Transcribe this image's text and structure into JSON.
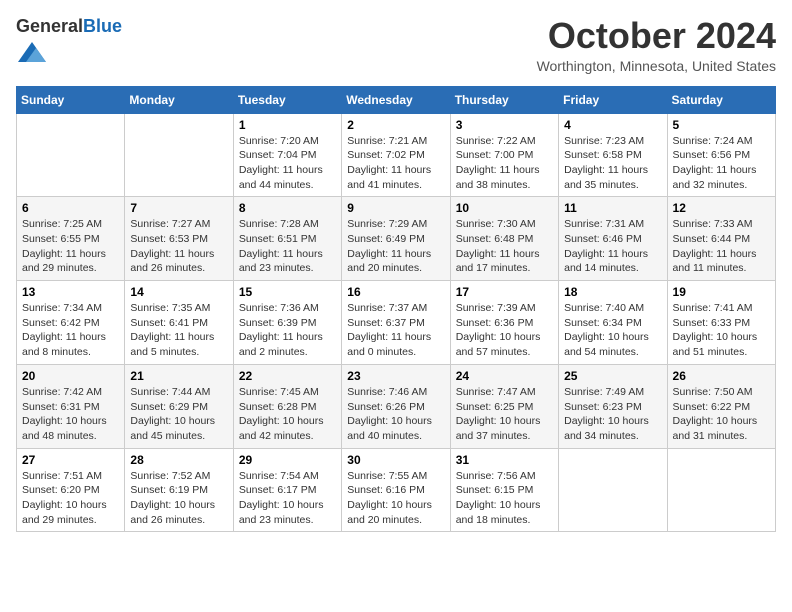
{
  "header": {
    "logo_general": "General",
    "logo_blue": "Blue",
    "month_title": "October 2024",
    "location": "Worthington, Minnesota, United States"
  },
  "weekdays": [
    "Sunday",
    "Monday",
    "Tuesday",
    "Wednesday",
    "Thursday",
    "Friday",
    "Saturday"
  ],
  "weeks": [
    [
      {
        "day": "",
        "info": ""
      },
      {
        "day": "",
        "info": ""
      },
      {
        "day": "1",
        "info": "Sunrise: 7:20 AM\nSunset: 7:04 PM\nDaylight: 11 hours and 44 minutes."
      },
      {
        "day": "2",
        "info": "Sunrise: 7:21 AM\nSunset: 7:02 PM\nDaylight: 11 hours and 41 minutes."
      },
      {
        "day": "3",
        "info": "Sunrise: 7:22 AM\nSunset: 7:00 PM\nDaylight: 11 hours and 38 minutes."
      },
      {
        "day": "4",
        "info": "Sunrise: 7:23 AM\nSunset: 6:58 PM\nDaylight: 11 hours and 35 minutes."
      },
      {
        "day": "5",
        "info": "Sunrise: 7:24 AM\nSunset: 6:56 PM\nDaylight: 11 hours and 32 minutes."
      }
    ],
    [
      {
        "day": "6",
        "info": "Sunrise: 7:25 AM\nSunset: 6:55 PM\nDaylight: 11 hours and 29 minutes."
      },
      {
        "day": "7",
        "info": "Sunrise: 7:27 AM\nSunset: 6:53 PM\nDaylight: 11 hours and 26 minutes."
      },
      {
        "day": "8",
        "info": "Sunrise: 7:28 AM\nSunset: 6:51 PM\nDaylight: 11 hours and 23 minutes."
      },
      {
        "day": "9",
        "info": "Sunrise: 7:29 AM\nSunset: 6:49 PM\nDaylight: 11 hours and 20 minutes."
      },
      {
        "day": "10",
        "info": "Sunrise: 7:30 AM\nSunset: 6:48 PM\nDaylight: 11 hours and 17 minutes."
      },
      {
        "day": "11",
        "info": "Sunrise: 7:31 AM\nSunset: 6:46 PM\nDaylight: 11 hours and 14 minutes."
      },
      {
        "day": "12",
        "info": "Sunrise: 7:33 AM\nSunset: 6:44 PM\nDaylight: 11 hours and 11 minutes."
      }
    ],
    [
      {
        "day": "13",
        "info": "Sunrise: 7:34 AM\nSunset: 6:42 PM\nDaylight: 11 hours and 8 minutes."
      },
      {
        "day": "14",
        "info": "Sunrise: 7:35 AM\nSunset: 6:41 PM\nDaylight: 11 hours and 5 minutes."
      },
      {
        "day": "15",
        "info": "Sunrise: 7:36 AM\nSunset: 6:39 PM\nDaylight: 11 hours and 2 minutes."
      },
      {
        "day": "16",
        "info": "Sunrise: 7:37 AM\nSunset: 6:37 PM\nDaylight: 11 hours and 0 minutes."
      },
      {
        "day": "17",
        "info": "Sunrise: 7:39 AM\nSunset: 6:36 PM\nDaylight: 10 hours and 57 minutes."
      },
      {
        "day": "18",
        "info": "Sunrise: 7:40 AM\nSunset: 6:34 PM\nDaylight: 10 hours and 54 minutes."
      },
      {
        "day": "19",
        "info": "Sunrise: 7:41 AM\nSunset: 6:33 PM\nDaylight: 10 hours and 51 minutes."
      }
    ],
    [
      {
        "day": "20",
        "info": "Sunrise: 7:42 AM\nSunset: 6:31 PM\nDaylight: 10 hours and 48 minutes."
      },
      {
        "day": "21",
        "info": "Sunrise: 7:44 AM\nSunset: 6:29 PM\nDaylight: 10 hours and 45 minutes."
      },
      {
        "day": "22",
        "info": "Sunrise: 7:45 AM\nSunset: 6:28 PM\nDaylight: 10 hours and 42 minutes."
      },
      {
        "day": "23",
        "info": "Sunrise: 7:46 AM\nSunset: 6:26 PM\nDaylight: 10 hours and 40 minutes."
      },
      {
        "day": "24",
        "info": "Sunrise: 7:47 AM\nSunset: 6:25 PM\nDaylight: 10 hours and 37 minutes."
      },
      {
        "day": "25",
        "info": "Sunrise: 7:49 AM\nSunset: 6:23 PM\nDaylight: 10 hours and 34 minutes."
      },
      {
        "day": "26",
        "info": "Sunrise: 7:50 AM\nSunset: 6:22 PM\nDaylight: 10 hours and 31 minutes."
      }
    ],
    [
      {
        "day": "27",
        "info": "Sunrise: 7:51 AM\nSunset: 6:20 PM\nDaylight: 10 hours and 29 minutes."
      },
      {
        "day": "28",
        "info": "Sunrise: 7:52 AM\nSunset: 6:19 PM\nDaylight: 10 hours and 26 minutes."
      },
      {
        "day": "29",
        "info": "Sunrise: 7:54 AM\nSunset: 6:17 PM\nDaylight: 10 hours and 23 minutes."
      },
      {
        "day": "30",
        "info": "Sunrise: 7:55 AM\nSunset: 6:16 PM\nDaylight: 10 hours and 20 minutes."
      },
      {
        "day": "31",
        "info": "Sunrise: 7:56 AM\nSunset: 6:15 PM\nDaylight: 10 hours and 18 minutes."
      },
      {
        "day": "",
        "info": ""
      },
      {
        "day": "",
        "info": ""
      }
    ]
  ]
}
